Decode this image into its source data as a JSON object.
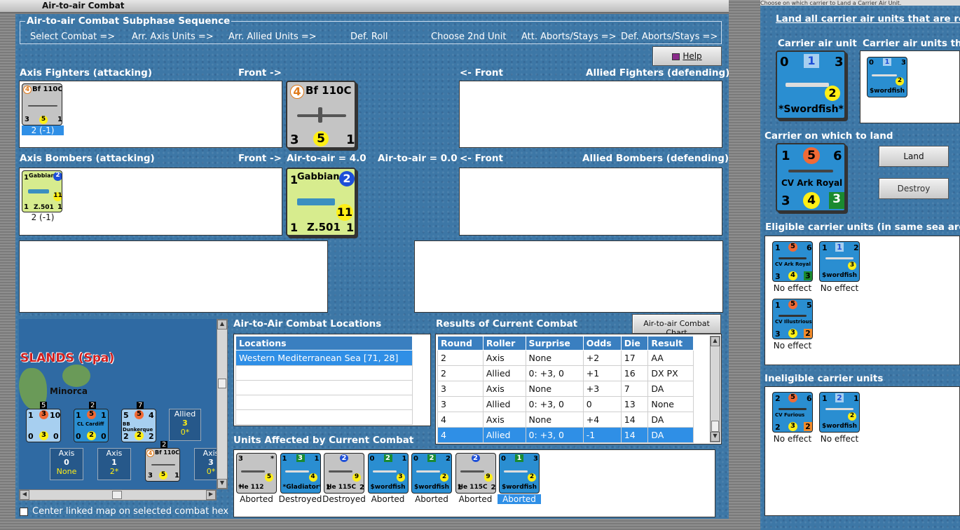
{
  "window": {
    "title": "Air-to-air Combat"
  },
  "right_top_text": "Choose on which carrier to Land a Carrier Air Unit.",
  "sequence": {
    "legend": "Air-to-air Combat Subphase Sequence",
    "steps": [
      "Select Combat =>",
      "Arr. Axis Units =>",
      "Arr. Allied Units =>",
      "Def. Roll",
      "Choose 2nd Unit",
      "Att. Aborts/Stays =>",
      "Def. Aborts/Stays =>"
    ]
  },
  "help_button": "Help",
  "axis_fighters": {
    "label": "Axis Fighters (attacking)",
    "front": "Front ->",
    "unit": {
      "name": "Bf 110C",
      "tl": "4",
      "bl": "3",
      "mid": "5",
      "br": "1",
      "caption": "2 (-1)"
    }
  },
  "allied_fighters": {
    "label": "Allied Fighters (defending)",
    "front": "<- Front"
  },
  "axis_bombers": {
    "label": "Axis Bombers (attacking)",
    "front": "Front ->",
    "unit": {
      "name": "Gabbiano",
      "sub": "Z.501",
      "tl": "1",
      "tr": "2",
      "mid": "11",
      "bl": "1",
      "br": "1",
      "caption": "2 (-1)"
    }
  },
  "allied_bombers": {
    "label": "Allied Bombers (defending)",
    "front": "<- Front"
  },
  "air_to_air_axis": "Air-to-air = 4.0",
  "air_to_air_allied": "Air-to-air = 0.0",
  "big_fighter": {
    "name": "Bf 110C",
    "tl": "4",
    "bl": "3",
    "mid": "5",
    "br": "1"
  },
  "big_bomber": {
    "name": "Gabbiano",
    "sub": "Z.501",
    "tl": "1",
    "tr": "2",
    "mid": "11",
    "bl": "1",
    "br": "1"
  },
  "map": {
    "region": "SLANDS (Spa)",
    "island": "Minorca",
    "stacks": [
      {
        "count": "5",
        "name": "",
        "tl": "1",
        "tm": "3",
        "tr": "10",
        "bl": "0",
        "bm": "3",
        "br": "0"
      },
      {
        "count": "2",
        "name": "CL Cardiff",
        "tl": "1",
        "tm": "5",
        "tr": "1",
        "bl": "0",
        "bm": "2",
        "br": "0"
      },
      {
        "count": "7",
        "name": "BB Dunkerque",
        "tl": "5",
        "tm": "5",
        "tr": "4",
        "bl": "2",
        "bm": "2",
        "br": "2"
      }
    ],
    "allied_box": {
      "side": "Allied",
      "num": "3",
      "sub": "0*"
    },
    "axis_boxes": [
      {
        "side": "Axis",
        "num": "0",
        "sub": "None"
      },
      {
        "side": "Axis",
        "num": "1",
        "sub": "2*"
      },
      {
        "side": "Axis",
        "num": "3",
        "sub": "0*"
      }
    ],
    "map_fighter": {
      "count": "2",
      "name": "Bf 110C",
      "tl": "4",
      "bl": "3",
      "mid": "5",
      "br": "1"
    },
    "center_checkbox": "Center linked map on selected combat hex"
  },
  "locations": {
    "label": "Air-to-Air Combat Locations",
    "header": "Locations",
    "items": [
      "Western Mediterranean Sea [71, 28]",
      "",
      "",
      "",
      ""
    ]
  },
  "results": {
    "label": "Results of Current Combat",
    "chart_button": "Air-to-air Combat Chart",
    "columns": [
      "Round",
      "Roller",
      "Surprise",
      "Odds",
      "Die",
      "Result"
    ],
    "rows": [
      [
        "2",
        "Axis",
        "None",
        "+2",
        "17",
        "AA"
      ],
      [
        "2",
        "Allied",
        "0: +3, 0",
        "+1",
        "16",
        "DX PX"
      ],
      [
        "3",
        "Axis",
        "None",
        "+3",
        "7",
        "DA"
      ],
      [
        "3",
        "Allied",
        "0: +3, 0",
        "0",
        "13",
        "None"
      ],
      [
        "4",
        "Axis",
        "None",
        "+4",
        "14",
        "DA"
      ],
      [
        "4",
        "Allied",
        "0: +3, 0",
        "-1",
        "14",
        "DA"
      ]
    ]
  },
  "affected": {
    "label": "Units Affected by Current Combat",
    "units": [
      {
        "name": "He 112",
        "tl": "3",
        "tr": "*",
        "mid": "5",
        "bl": "*",
        "status": "Aborted",
        "type": "gray"
      },
      {
        "name": "*Gladiator*",
        "tl": "1",
        "tm": "3",
        "tr": "1",
        "mid": "4",
        "status": "Destroyed",
        "type": "blu"
      },
      {
        "name": "He 115C",
        "tl": "",
        "tm": "2",
        "tr": "",
        "mid": "9",
        "bl": "1",
        "br": "2",
        "status": "Destroyed",
        "type": "gray"
      },
      {
        "name": "$wordfish",
        "tl": "0",
        "tm": "2",
        "tr": "1",
        "mid": "3",
        "status": "Aborted",
        "type": "blu"
      },
      {
        "name": "$wordfish",
        "tl": "0",
        "tm": "2",
        "tr": "2",
        "mid": "2",
        "status": "Aborted",
        "type": "blu"
      },
      {
        "name": "He 115C",
        "tl": "",
        "tm": "2",
        "tr": "",
        "mid": "9",
        "bl": "1",
        "br": "2",
        "status": "Aborted",
        "type": "gray"
      },
      {
        "name": "$wordfish",
        "tl": "0",
        "tm": "1",
        "tr": "3",
        "mid": "2",
        "status": "Aborted",
        "type": "blu"
      }
    ]
  },
  "right": {
    "instruction": "Land all carrier air units that are retu",
    "carrier_air_label": "Carrier air unit",
    "carrier_air_units_label": "Carrier air units tha",
    "big_swordfish": {
      "name": "*Swordfish*",
      "tl": "0",
      "tm": "1",
      "tr": "3",
      "mid": "2"
    },
    "small_swordfish": {
      "name": "$wordfish",
      "tl": "0",
      "tm": "1",
      "tr": "3",
      "mid": "2"
    },
    "carrier_land_label": "Carrier on which to land",
    "big_carrier": {
      "name": "CV Ark Royal",
      "tl": "1",
      "tm": "5",
      "tr": "6",
      "bl": "3",
      "bm": "4",
      "br": "3"
    },
    "land_button": "Land",
    "destroy_button": "Destroy",
    "eligible_label": "Eligible carrier units (in same sea area",
    "eligible": [
      {
        "name": "CV Ark Royal",
        "tl": "1",
        "tm": "5",
        "tr": "6",
        "bl": "3",
        "bm": "4",
        "br": "3",
        "caption": "No effect",
        "kind": "carrier"
      },
      {
        "name": "$wordfish",
        "tl": "1",
        "tm": "1",
        "tr": "2",
        "mid": "3",
        "caption": "No effect",
        "kind": "plane"
      },
      {
        "name": "CV Illustrious",
        "tl": "1",
        "tm": "5",
        "tr": "5",
        "bl": "3",
        "bm": "3",
        "br": "2",
        "caption": "No effect",
        "kind": "carrier"
      }
    ],
    "ineligible_label": "Ineligible carrier units",
    "ineligible": [
      {
        "name": "CV Furious",
        "tl": "2",
        "tm": "5",
        "tr": "6",
        "bl": "2",
        "bm": "3",
        "br": "2",
        "caption": "No effect",
        "kind": "carrier"
      },
      {
        "name": "$wordfish",
        "tl": "1",
        "tm": "2",
        "tr": "1",
        "mid": "2",
        "caption": "No effect",
        "kind": "plane"
      }
    ]
  }
}
